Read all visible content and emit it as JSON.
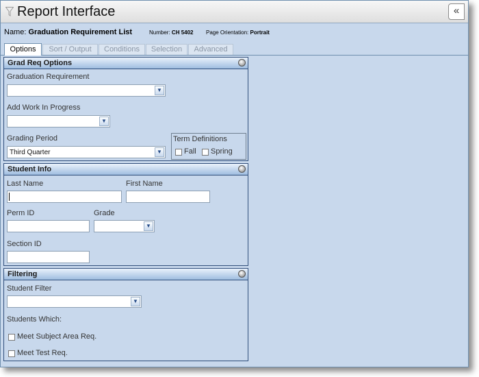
{
  "window": {
    "title": "Report Interface",
    "collapse_label": "«"
  },
  "info": {
    "name_label": "Name:",
    "name_value": "Graduation Requirement List",
    "number_label": "Number:",
    "number_value": "CH 5402",
    "orientation_label": "Page Orientation:",
    "orientation_value": "Portrait"
  },
  "tabs": [
    {
      "label": "Options",
      "active": true
    },
    {
      "label": "Sort / Output",
      "active": false
    },
    {
      "label": "Conditions",
      "active": false
    },
    {
      "label": "Selection",
      "active": false
    },
    {
      "label": "Advanced",
      "active": false
    }
  ],
  "grad_req": {
    "title": "Grad Req Options",
    "graduation_requirement_label": "Graduation Requirement",
    "graduation_requirement_value": "",
    "work_in_progress_label": "Add Work In Progress",
    "work_in_progress_value": "",
    "grading_period_label": "Grading Period",
    "grading_period_value": "Third Quarter",
    "term_definitions_label": "Term Definitions",
    "fall_label": "Fall",
    "spring_label": "Spring"
  },
  "student_info": {
    "title": "Student Info",
    "last_name_label": "Last Name",
    "first_name_label": "First Name",
    "perm_id_label": "Perm ID",
    "grade_label": "Grade",
    "section_id_label": "Section ID"
  },
  "filtering": {
    "title": "Filtering",
    "student_filter_label": "Student Filter",
    "student_filter_value": "",
    "students_which_label": "Students Which:",
    "meet_subject_label": "Meet Subject Area Req.",
    "meet_test_label": "Meet Test Req."
  }
}
